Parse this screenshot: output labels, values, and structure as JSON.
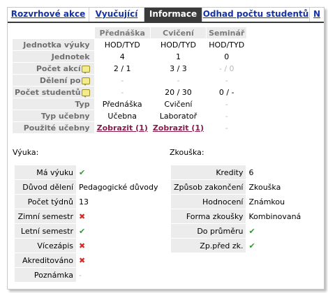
{
  "tabs": [
    "Rozvrhové akce",
    "Vyučující",
    "Informace",
    "Odhad počtu studentů",
    "N"
  ],
  "grid": {
    "columns": [
      "Přednáška",
      "Cvičení",
      "Seminář"
    ],
    "rows": [
      {
        "label": "Jednotka výuky",
        "cells": [
          "HOD/TYD",
          "HOD/TYD",
          "HOD/TYD"
        ]
      },
      {
        "label": "Jednotek",
        "cells": [
          "4",
          "1",
          "0"
        ]
      },
      {
        "label": "Počet akcí",
        "cells": [
          "2 / 1",
          "3 / 3",
          "- / 0"
        ]
      },
      {
        "label": "Dělení po",
        "cells": [
          "-",
          "-",
          "-"
        ]
      },
      {
        "label": "Počet studentů",
        "cells": [
          "-",
          "20 / 30",
          "0 / -"
        ]
      },
      {
        "label": "Typ",
        "cells": [
          "Přednáška",
          "Cvičení",
          "-"
        ]
      },
      {
        "label": "Typ učebny",
        "cells": [
          "Učebna",
          "Laboratoř",
          "-"
        ]
      },
      {
        "label": "Použité učebny",
        "cells": [
          "Zobrazit (1)",
          "Zobrazit (1)",
          "-"
        ]
      }
    ]
  },
  "vyuka": {
    "heading": "Výuka:",
    "rows": [
      {
        "label": "Má výuku",
        "value": "✔"
      },
      {
        "label": "Důvod dělení",
        "value": "Pedagogické důvody"
      },
      {
        "label": "Počet týdnů",
        "value": "13"
      },
      {
        "label": "Zimní semestr",
        "value": "✖"
      },
      {
        "label": "Letní semestr",
        "value": "✔"
      },
      {
        "label": "Vícezápis",
        "value": "✖"
      },
      {
        "label": "Akreditováno",
        "value": "✖"
      },
      {
        "label": "Poznámka",
        "value": "-"
      }
    ]
  },
  "zkouska": {
    "heading": "Zkouška:",
    "rows": [
      {
        "label": "Kredity",
        "value": "6"
      },
      {
        "label": "Způsob zakončení",
        "value": "Zkouška"
      },
      {
        "label": "Hodnocení",
        "value": "Známkou"
      },
      {
        "label": "Forma zkoušky",
        "value": "Kombinovaná"
      },
      {
        "label": "Do průměru",
        "value": "✔"
      },
      {
        "label": "Zp.před zk.",
        "value": "✔"
      }
    ]
  },
  "colors": {
    "accent": "#1633a6",
    "active_tab": "#3a3a3a",
    "link": "#8a1a4a",
    "check": "#2f9a2f",
    "cross": "#d62a2a"
  }
}
